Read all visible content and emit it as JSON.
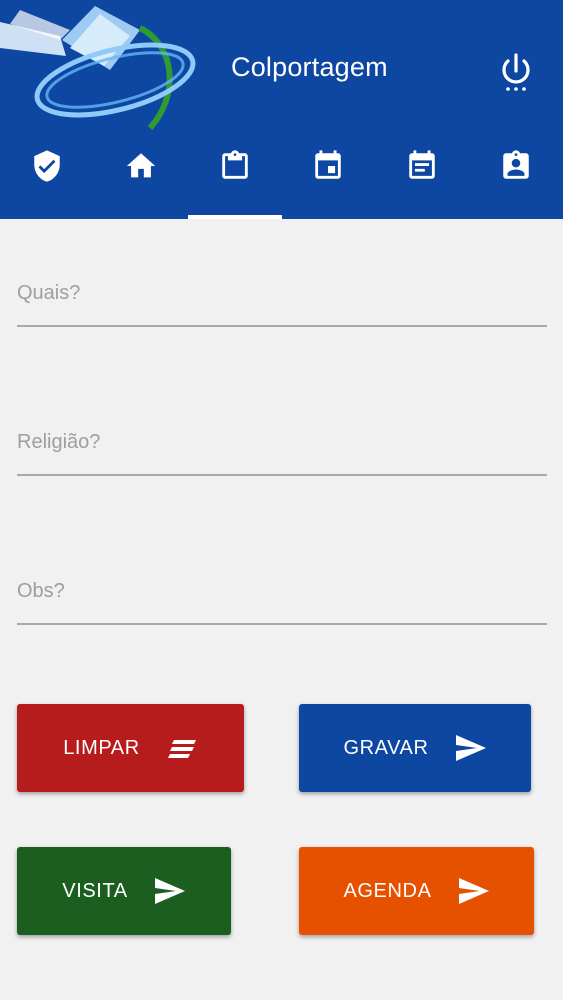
{
  "header": {
    "title": "Colportagem",
    "background": "#0d47a1",
    "logo_icon": "book-globe-logo",
    "power_icon": "power-icon"
  },
  "tabs": [
    {
      "icon": "shield-check-icon",
      "active": false
    },
    {
      "icon": "home-icon",
      "active": false
    },
    {
      "icon": "clipboard-icon",
      "active": true
    },
    {
      "icon": "calendar-event-icon",
      "active": false
    },
    {
      "icon": "calendar-note-icon",
      "active": false
    },
    {
      "icon": "badge-id-icon",
      "active": false
    }
  ],
  "form": {
    "quais_placeholder": "Quais?",
    "religiao_placeholder": "Religião?",
    "obs_placeholder": "Obs?"
  },
  "buttons": {
    "limpar": {
      "label": "LIMPAR",
      "color": "#b71c1c",
      "icon": "clear-lines-icon"
    },
    "gravar": {
      "label": "GRAVAR",
      "color": "#0d47a1",
      "icon": "send-icon"
    },
    "visita": {
      "label": "VISITA",
      "color": "#1b5e20",
      "icon": "send-icon"
    },
    "agenda": {
      "label": "AGENDA",
      "color": "#e65100",
      "icon": "send-icon"
    }
  }
}
